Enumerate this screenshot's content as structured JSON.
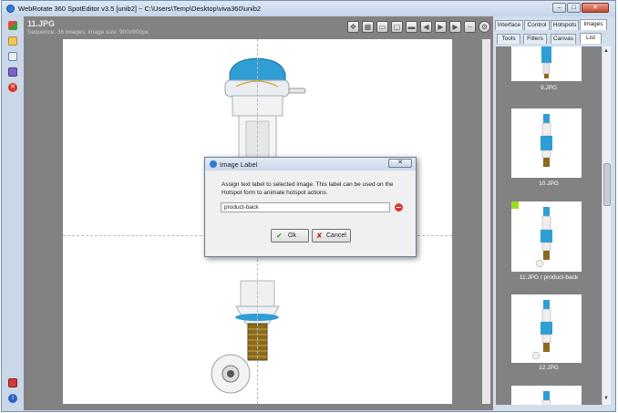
{
  "window": {
    "title": "WebRotate 360 SpotEditor v3.5 [unib2] ~ C:\\Users\\Temp\\Desktop\\viva360\\unib2",
    "buttons": {
      "minimize": "–",
      "maximize": "□",
      "close": "✕"
    }
  },
  "main": {
    "image_title": "11.JPG",
    "image_subtitle": "Sequence: 36 images; image size: 900x900px"
  },
  "right_panel": {
    "tabs": [
      "Interface",
      "Control",
      "Hotspots",
      "Images"
    ],
    "active_tab": "Images",
    "subtabs": [
      "Tools",
      "Filters",
      "Canvas",
      "List"
    ],
    "active_subtab": "List",
    "thumbnails": [
      {
        "label": "9.JPG",
        "selected": false
      },
      {
        "label": "10.JPG",
        "selected": false
      },
      {
        "label": "11.JPG / product-back",
        "selected": true
      },
      {
        "label": "12.JPG",
        "selected": false
      }
    ]
  },
  "dialog": {
    "title": "Image Label",
    "close": "✕",
    "description": "Assign text label to selected image.  This label can be used on the Hotspot form to animate hotspot actions.",
    "input_value": "product-back",
    "ok_label": "Ok",
    "cancel_label": "Cancel"
  },
  "colors": {
    "accent_blue": "#2f9ed4",
    "selection_marker": "#99dd22",
    "canvas_background": "#828282"
  },
  "icons": {
    "main_toolbar": [
      "move-icon",
      "grid-icon",
      "fit-icon",
      "window-icon",
      "frame-icon",
      "prev-icon",
      "play-icon",
      "next-icon",
      "minus-icon",
      "settings-icon"
    ],
    "left_toolbar": [
      "new-project-icon",
      "open-icon",
      "email-icon",
      "save-icon",
      "delete-icon",
      "publish-icon",
      "help-icon"
    ]
  }
}
